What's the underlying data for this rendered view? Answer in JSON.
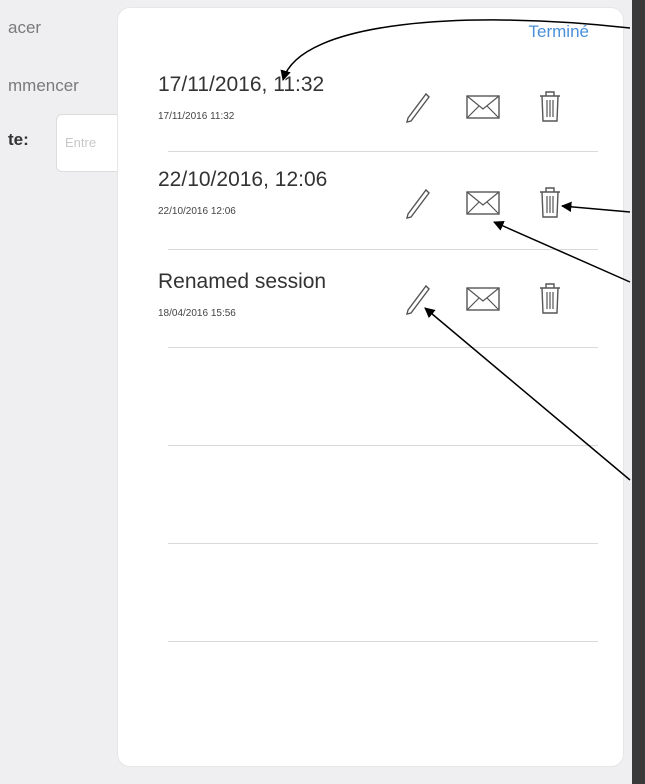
{
  "background": {
    "labels": [
      "acer",
      "mmencer",
      "te:"
    ],
    "field_placeholder": "Entre"
  },
  "panel": {
    "done_label": "Terminé",
    "sessions": [
      {
        "title": "17/11/2016, 11:32",
        "subtitle": "17/11/2016 11:32"
      },
      {
        "title": "22/10/2016, 12:06",
        "subtitle": "22/10/2016 12:06"
      },
      {
        "title": "Renamed session",
        "subtitle": "18/04/2016 15:56"
      }
    ]
  },
  "colors": {
    "accent": "#4a90d9",
    "separator": "#d9d9d9",
    "icon": "#555555"
  },
  "icons": [
    "pencil-icon",
    "envelope-icon",
    "trash-icon"
  ]
}
